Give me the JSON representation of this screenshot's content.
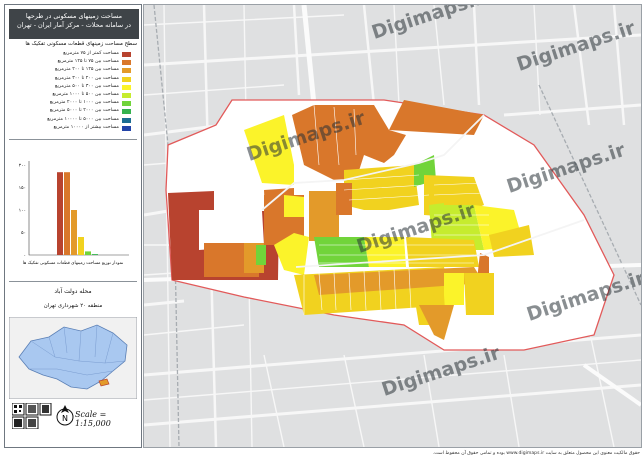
{
  "title": {
    "line1": "مساحت زمینهای مسکونی در طرحها",
    "line2": "در سامانه محلات - مرکز آمار ایران - تهران"
  },
  "legend": {
    "heading": "سطح مساحت زمینهای قطعات مسکونی تفکیک ها",
    "items": [
      {
        "label": "مساحت کمتر از ۷۵ مترمربع",
        "color": "#b8432f"
      },
      {
        "label": "مساحت بین ۷۵ تا ۱۲۵ مترمربع",
        "color": "#d9772b"
      },
      {
        "label": "مساحت بین ۱۲۵ تا ۲۰۰ مترمربع",
        "color": "#e39a2a"
      },
      {
        "label": "مساحت بین ۲۰۰ تا ۳۰۰ مترمربع",
        "color": "#f1d21f"
      },
      {
        "label": "مساحت بین ۳۰۰ تا ۵۰۰ مترمربع",
        "color": "#fbf32a"
      },
      {
        "label": "مساحت بین ۵۰۰ تا ۱۰۰۰ مترمربع",
        "color": "#c6ec2e"
      },
      {
        "label": "مساحت بین ۱۰۰۰ تا ۲۰۰۰ مترمربع",
        "color": "#71d43a"
      },
      {
        "label": "مساحت بین ۲۰۰۰ تا ۵۰۰۰ مترمربع",
        "color": "#35b24e"
      },
      {
        "label": "مساحت بین ۵۰۰۰ تا ۱۰۰۰۰ مترمربع",
        "color": "#1c6d92"
      },
      {
        "label": "مساحت بیشتر از ۱۰۰۰۰ مترمربع",
        "color": "#2344a8"
      }
    ]
  },
  "histogram": {
    "bars": [
      0,
      0,
      0,
      0,
      0,
      0.92,
      0.92,
      0.5,
      0.2,
      0.04,
      0.01
    ],
    "y_ticks": [
      "۲۰۰",
      "۱۵۰",
      "۱۰۰",
      "۵۰",
      "۰"
    ],
    "caption": "نمودار توزیع مساحت زمینهای قطعات مسکونی تفکیک ها"
  },
  "district": {
    "name": "محله دولت آباد",
    "region": "منطقه ۲۰ شهرداری تهران"
  },
  "scale": "Scale = 1:15,000",
  "north_label": "N",
  "watermark": "Digimaps.ir",
  "footer": "حقوق مالکیت معنوی این محصول متعلق به سایت www.digimaps.ir بوده و تمامی حقوق آن محفوظ است.",
  "colors": {
    "boundary": "#e25a5a",
    "map_bg": "#dfe0e1",
    "road": "#f4f4f4"
  }
}
